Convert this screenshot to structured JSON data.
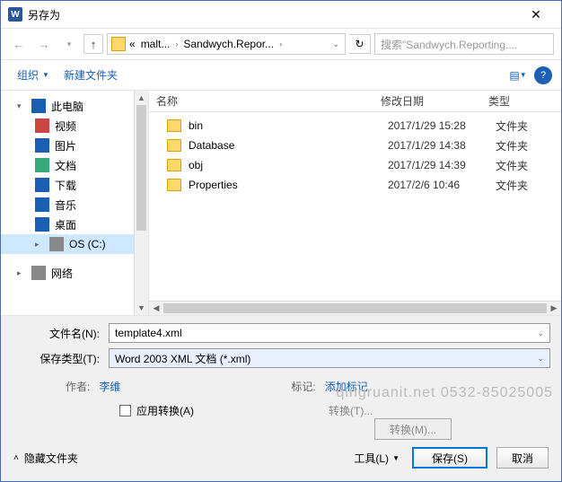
{
  "title": "另存为",
  "breadcrumb": {
    "sep": "«",
    "p1": "malt...",
    "p2": "Sandwych.Repor...",
    "tail": "›"
  },
  "search_placeholder": "搜索\"Sandwych.Reporting....",
  "toolbar": {
    "organize": "组织",
    "newfolder": "新建文件夹"
  },
  "sidebar": {
    "items": [
      {
        "label": "此电脑"
      },
      {
        "label": "视频"
      },
      {
        "label": "图片"
      },
      {
        "label": "文档"
      },
      {
        "label": "下载"
      },
      {
        "label": "音乐"
      },
      {
        "label": "桌面"
      },
      {
        "label": "OS (C:)"
      },
      {
        "label": "网络"
      }
    ]
  },
  "columns": {
    "name": "名称",
    "date": "修改日期",
    "type": "类型"
  },
  "files": [
    {
      "name": "bin",
      "date": "2017/1/29 15:28",
      "type": "文件夹"
    },
    {
      "name": "Database",
      "date": "2017/1/29 14:38",
      "type": "文件夹"
    },
    {
      "name": "obj",
      "date": "2017/1/29 14:39",
      "type": "文件夹"
    },
    {
      "name": "Properties",
      "date": "2017/2/6 10:46",
      "type": "文件夹"
    }
  ],
  "form": {
    "filename_label": "文件名(N):",
    "filename_value": "template4.xml",
    "filetype_label": "保存类型(T):",
    "filetype_value": "Word 2003 XML 文档 (*.xml)"
  },
  "meta": {
    "author_label": "作者:",
    "author_value": "李维",
    "tag_label": "标记:",
    "tag_value": "添加标记"
  },
  "convert": {
    "check_label": "应用转换(A)",
    "t_label": "转换(T)...",
    "btn": "转换(M)..."
  },
  "footer": {
    "hide": "隐藏文件夹",
    "tools": "工具(L)",
    "save": "保存(S)",
    "cancel": "取消"
  },
  "watermark": "qingruanit.net 0532-85025005"
}
